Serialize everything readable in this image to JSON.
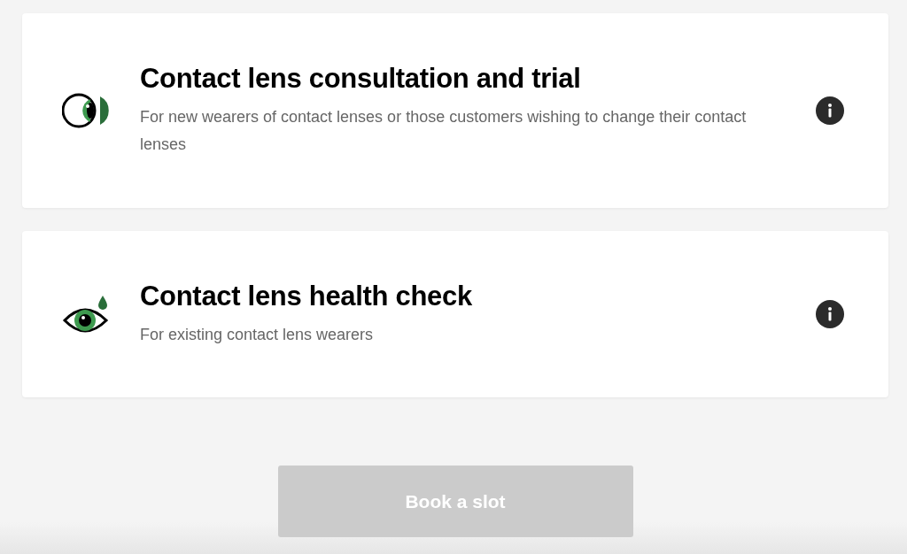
{
  "services": [
    {
      "kind": "lens",
      "title": "Contact lens consultation and trial",
      "description": "For new wearers of contact lenses or those customers wishing to change their contact lenses"
    },
    {
      "kind": "drop",
      "title": "Contact lens health check",
      "description": "For existing contact lens wearers"
    }
  ],
  "book_button": {
    "label": "Book a slot",
    "disabled": true
  }
}
